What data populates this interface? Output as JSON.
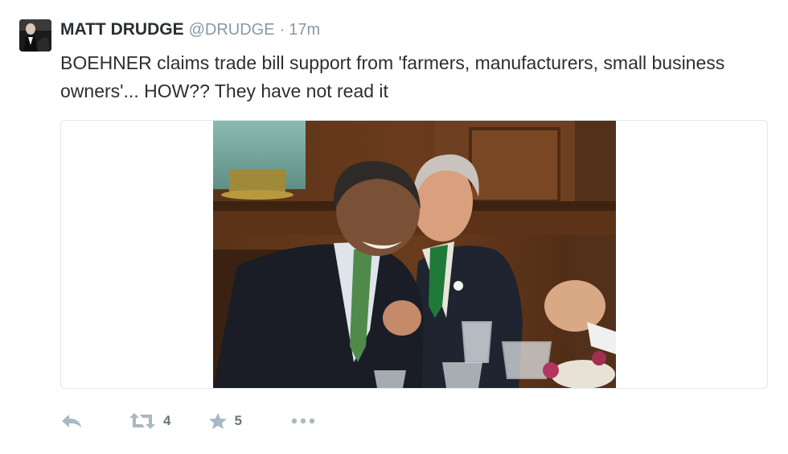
{
  "author": {
    "name": "MATT DRUDGE",
    "handle": "@DRUDGE",
    "separator": "·",
    "time": "17m"
  },
  "tweet": {
    "text": "BOEHNER claims trade bill support from 'farmers, manufacturers, small business owners'... HOW?? They have not read it"
  },
  "media": {
    "type": "photo"
  },
  "actions": {
    "reply_icon": "reply-icon",
    "retweet_icon": "retweet-icon",
    "retweet_count": "4",
    "favorite_icon": "star-icon",
    "favorite_count": "5",
    "more_icon": "more-dots-icon"
  },
  "colors": {
    "text": "#292f33",
    "muted": "#8899a6",
    "icon": "#aab8c2",
    "border": "#e1e8ed"
  }
}
